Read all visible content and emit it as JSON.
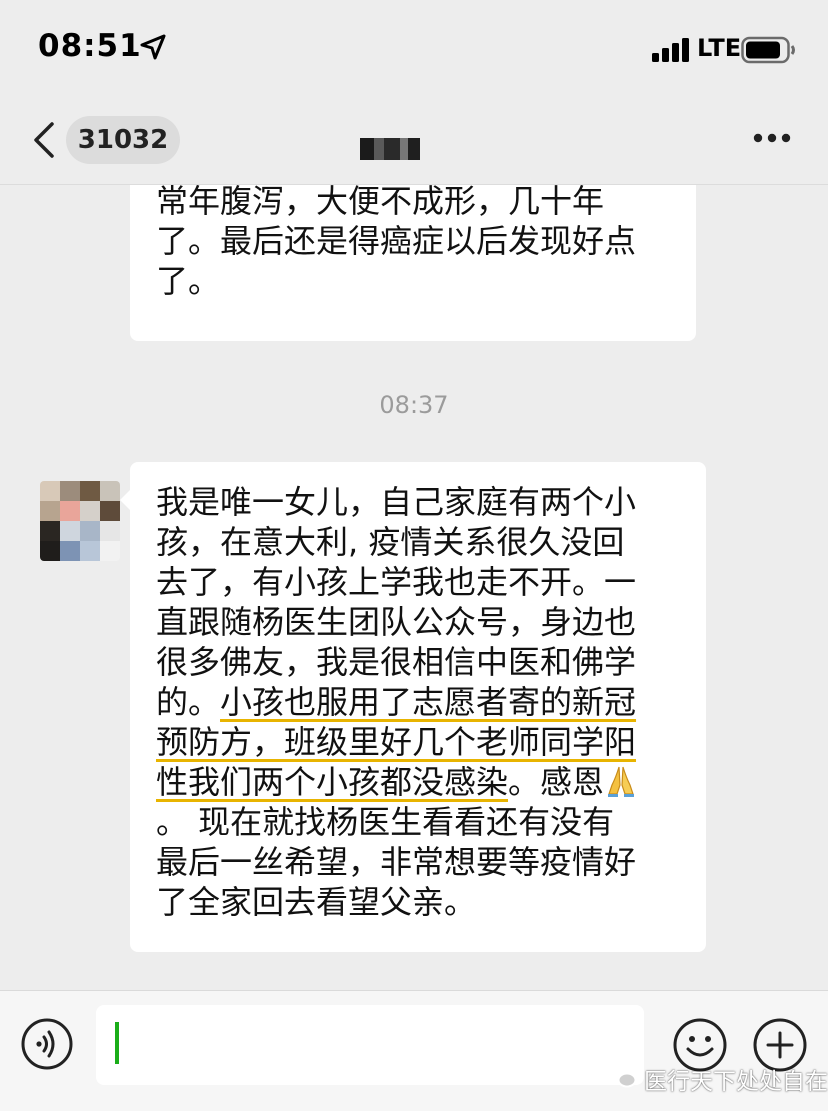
{
  "status_bar": {
    "time": "08:51",
    "network": "LTE",
    "icons": [
      "location-arrow-icon",
      "signal-icon",
      "battery-icon"
    ]
  },
  "nav": {
    "chat_id": "31032",
    "icons": [
      "back-icon",
      "more-icon"
    ]
  },
  "messages": {
    "previous": {
      "lines": [
        "常年腹泻，大便不成形，几十年",
        "了。最后还是得癌症以后发现好点",
        "了。"
      ]
    },
    "timestamp": "08:37",
    "main": {
      "lines": [
        {
          "segments": [
            {
              "text": "我是唯一女儿，自己家庭有两个小",
              "highlight": false
            }
          ]
        },
        {
          "segments": [
            {
              "text": "孩，在意大利, 疫情关系很久没回",
              "highlight": false
            }
          ]
        },
        {
          "segments": [
            {
              "text": "去了，有小孩上学我也走不开。一",
              "highlight": false
            }
          ]
        },
        {
          "segments": [
            {
              "text": "直跟随杨医生团队公众号，身边也",
              "highlight": false
            }
          ]
        },
        {
          "segments": [
            {
              "text": "很多佛友，我是很相信中医和佛学",
              "highlight": false
            }
          ]
        },
        {
          "segments": [
            {
              "text": "的。",
              "highlight": false
            },
            {
              "text": "小孩也服用了志愿者寄的新冠",
              "highlight": true
            }
          ]
        },
        {
          "segments": [
            {
              "text": "预防方，班级里好几个老师同学阳",
              "highlight": true
            }
          ]
        },
        {
          "segments": [
            {
              "text": "性我们两个小孩都没感染",
              "highlight": true
            },
            {
              "text": "。感恩",
              "highlight": false
            }
          ],
          "emoji": "praying-hands-icon"
        },
        {
          "segments": [
            {
              "text": "。 现在就找杨医生看看还有没有",
              "highlight": false
            }
          ]
        },
        {
          "segments": [
            {
              "text": "最后一丝希望，非常想要等疫情好",
              "highlight": false
            }
          ]
        },
        {
          "segments": [
            {
              "text": "了全家回去看望父亲。",
              "highlight": false
            }
          ]
        }
      ]
    }
  },
  "input_bar": {
    "placeholder": "",
    "icons": [
      "voice-icon",
      "emoji-icon",
      "add-icon"
    ]
  },
  "watermark": {
    "text": "医行天下处处自在"
  },
  "colors": {
    "background": "#ededed",
    "bubble": "#ffffff",
    "highlight_underline": "#e8b400",
    "caret": "#1aad19",
    "timestamp": "#9b9b9b"
  }
}
